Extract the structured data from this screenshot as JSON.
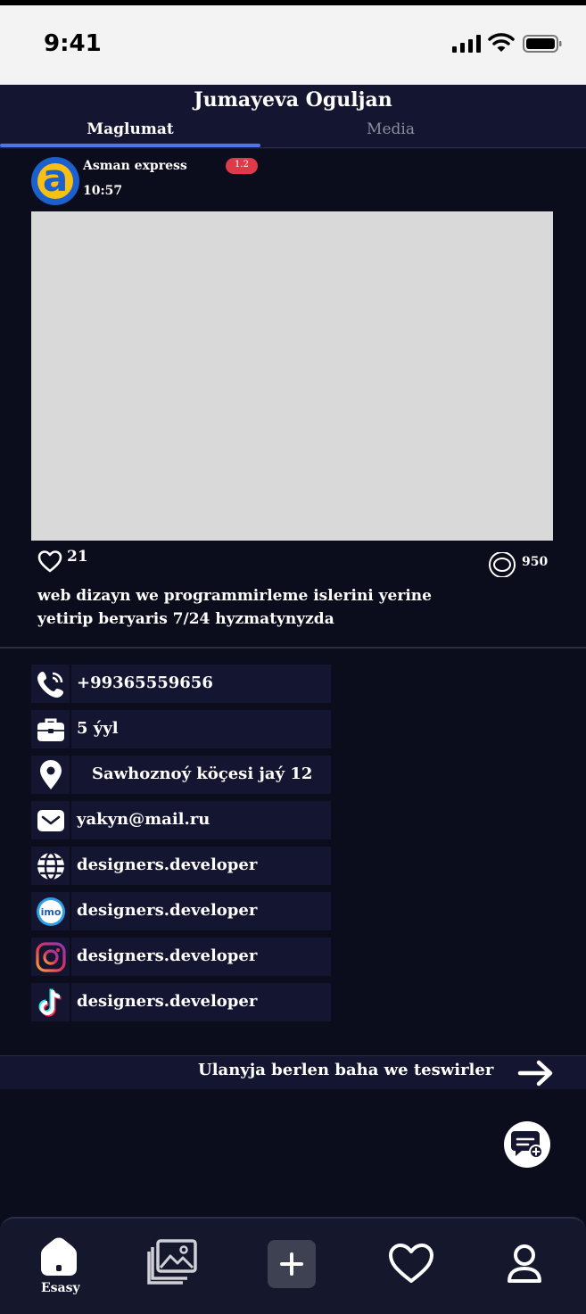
{
  "status_bar": {
    "time": "9:41"
  },
  "header": {
    "title": "Jumayeva Oguljan",
    "tabs": [
      {
        "label": "Maglumat"
      },
      {
        "label": "Media"
      }
    ]
  },
  "post": {
    "author": "Asman express",
    "time": "10:57",
    "badge": "1.2",
    "likes": "21",
    "views": "950",
    "description": "web dizayn we programmirleme islerini yerine yetirip beryaris 7/24 hyzmatynyzda"
  },
  "info": [
    {
      "icon": "phone-icon",
      "text": "+99365559656"
    },
    {
      "icon": "briefcase-icon",
      "text": "5 ýyl"
    },
    {
      "icon": "location-pin-icon",
      "text": "Sawhoznoý köçesi jaý 12"
    },
    {
      "icon": "mail-icon",
      "text": "yakyn@mail.ru"
    },
    {
      "icon": "globe-icon",
      "text": "designers.developer"
    },
    {
      "icon": "imo-icon",
      "text": "designers.developer"
    },
    {
      "icon": "instagram-icon",
      "text": "designers.developer"
    },
    {
      "icon": "tiktok-icon",
      "text": "designers.developer"
    }
  ],
  "reviews": {
    "label": "Ulanyja berlen baha we teswirler"
  },
  "bottom_nav": {
    "home_label": "Esasy"
  },
  "colors": {
    "accent": "#4a78e8",
    "badge": "#e0394a",
    "background": "#0b0c1c",
    "panel": "#141530"
  }
}
